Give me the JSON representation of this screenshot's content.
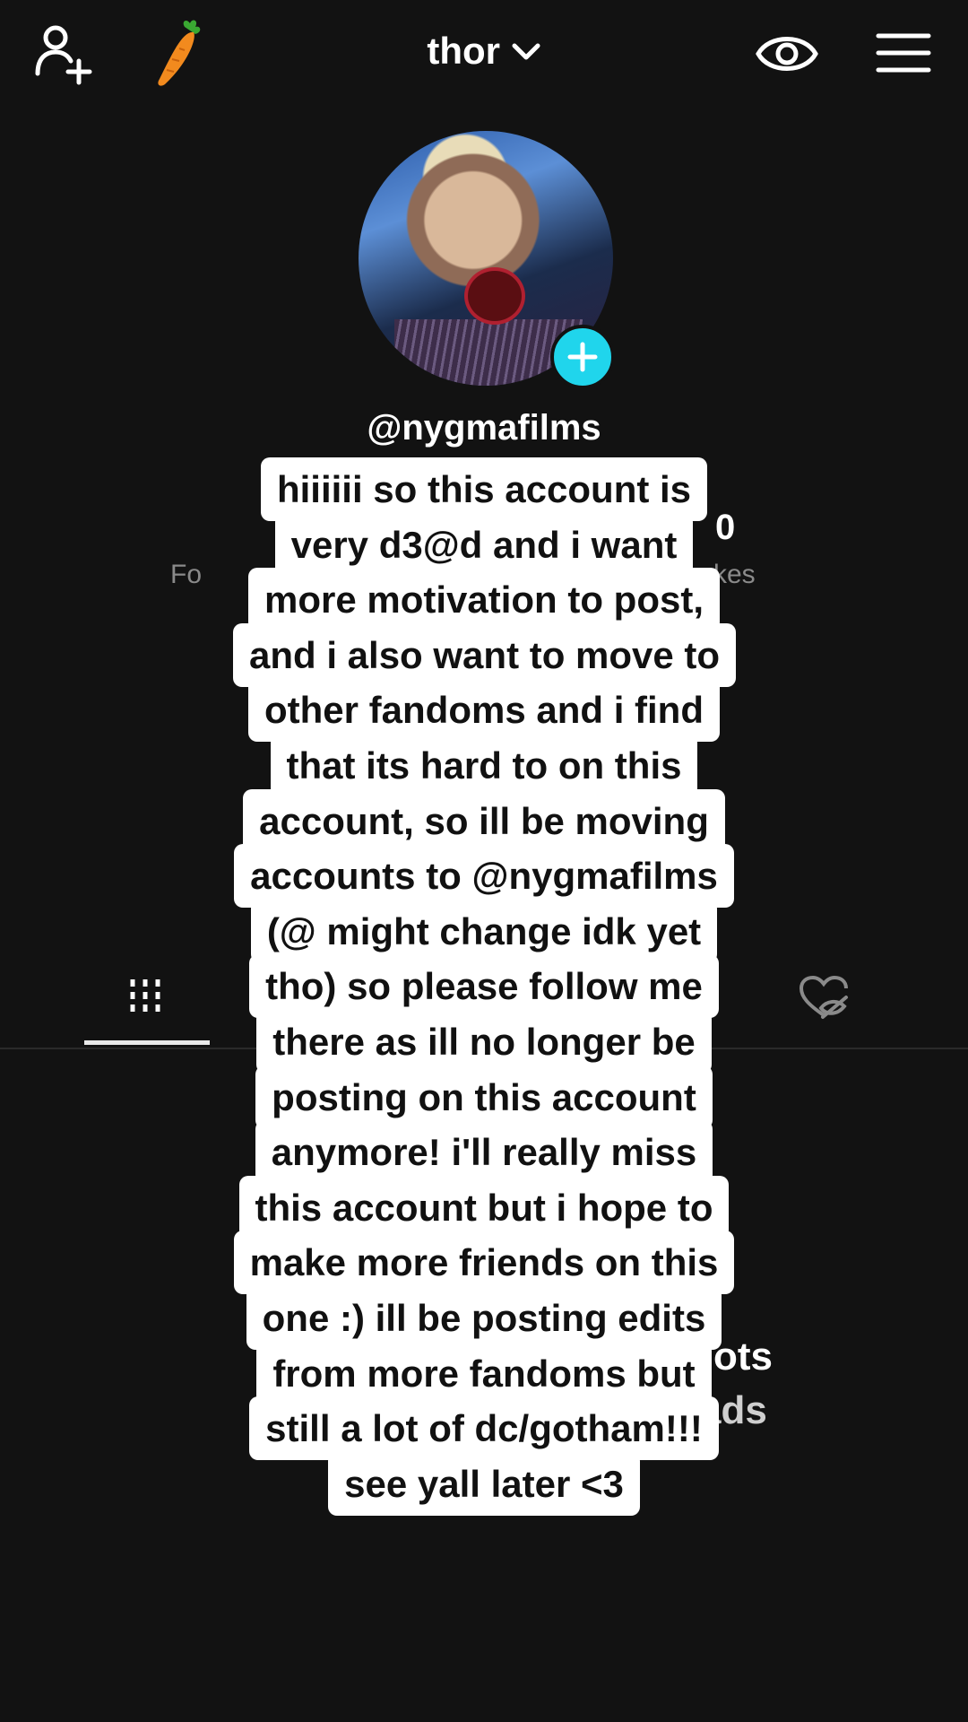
{
  "header": {
    "username": "thor",
    "icons": [
      "add-user-icon",
      "carrot-icon",
      "chevron-down-icon",
      "eye-icon",
      "menu-icon"
    ]
  },
  "profile": {
    "handle": "@nygmafilms",
    "stats_partial": {
      "left_label_fragment": "Fo",
      "right_value_fragment": "0",
      "right_label_fragment": "kes"
    }
  },
  "tabs": {
    "icons": [
      "grid-icon",
      "liked-hidden-icon"
    ]
  },
  "background_fragments": {
    "right_line_1": "ots",
    "right_line_2": "ads"
  },
  "caption": {
    "text": "hiiiiii so this account is very d3@d and i want more motivation to post, and i also want to move to other fandoms and i find that its hard to on this account, so ill be moving accounts to @nygmafilms (@ might change idk yet tho) so please follow me there as ill no longer be posting on this account anymore! i'll really miss this account but i hope to make more friends on this one :) ill be posting edits from more fandoms but still a lot of dc/gotham!!! see yall later <3"
  },
  "colors": {
    "background": "#121212",
    "accent": "#20d5ec",
    "caption_bg": "#ffffff",
    "caption_text": "#111111"
  }
}
